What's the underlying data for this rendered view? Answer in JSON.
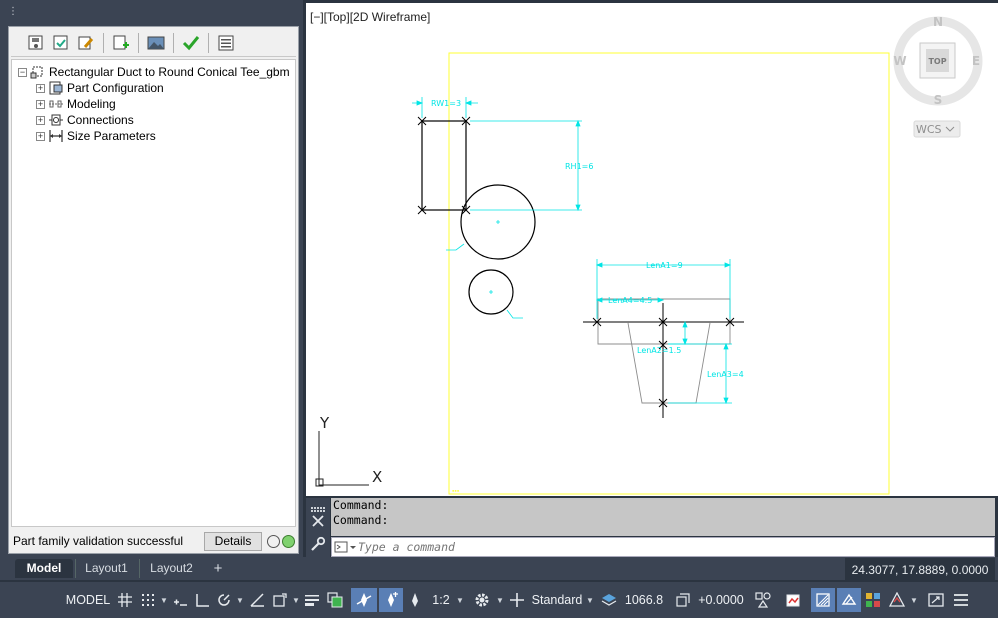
{
  "palette": {
    "grip": "⋮",
    "toolbar": [
      "save-part-icon",
      "validate-icon",
      "edit-icon",
      "add-icon",
      "image-icon",
      "check-icon",
      "catalog-icon"
    ],
    "tree": {
      "root": "Rectangular Duct to Round Conical Tee_gbm",
      "items": [
        {
          "label": "Part Configuration",
          "icon": "part-config-icon"
        },
        {
          "label": "Modeling",
          "icon": "modeling-icon"
        },
        {
          "label": "Connections",
          "icon": "connections-icon"
        },
        {
          "label": "Size Parameters",
          "icon": "size-params-icon"
        }
      ]
    },
    "status": "Part family validation successful",
    "details_label": "Details"
  },
  "viewport": {
    "label": "[−][Top][2D Wireframe]",
    "viewcube": {
      "north": "N",
      "south": "S",
      "east": "E",
      "west": "W",
      "face": "TOP",
      "wcs": "WCS"
    },
    "ucs": {
      "x": "X",
      "y": "Y"
    },
    "dimensions": {
      "rw1": "RW1=3",
      "rh1": "RH1=6",
      "lena1": "LenA1=9",
      "lena4": "LenA4=4.5",
      "lena2": "LenA2=1.5",
      "lena3": "LenA3=4"
    }
  },
  "command": {
    "history": [
      "Command:",
      "Command:"
    ],
    "placeholder": "Type a command"
  },
  "tabs": {
    "model": "Model",
    "layout1": "Layout1",
    "layout2": "Layout2",
    "add": "+"
  },
  "coords": "24.3077, 17.8889, 0.0000",
  "statusbar": {
    "model": "MODEL",
    "scale": "1:2",
    "style": "Standard",
    "elevation": "1066.8",
    "offset": "+0.0000"
  },
  "colors": {
    "cyan": "#00e5e5",
    "yellow": "#ffff33",
    "accent": "#5a7fb5",
    "check": "#2aa52a"
  }
}
